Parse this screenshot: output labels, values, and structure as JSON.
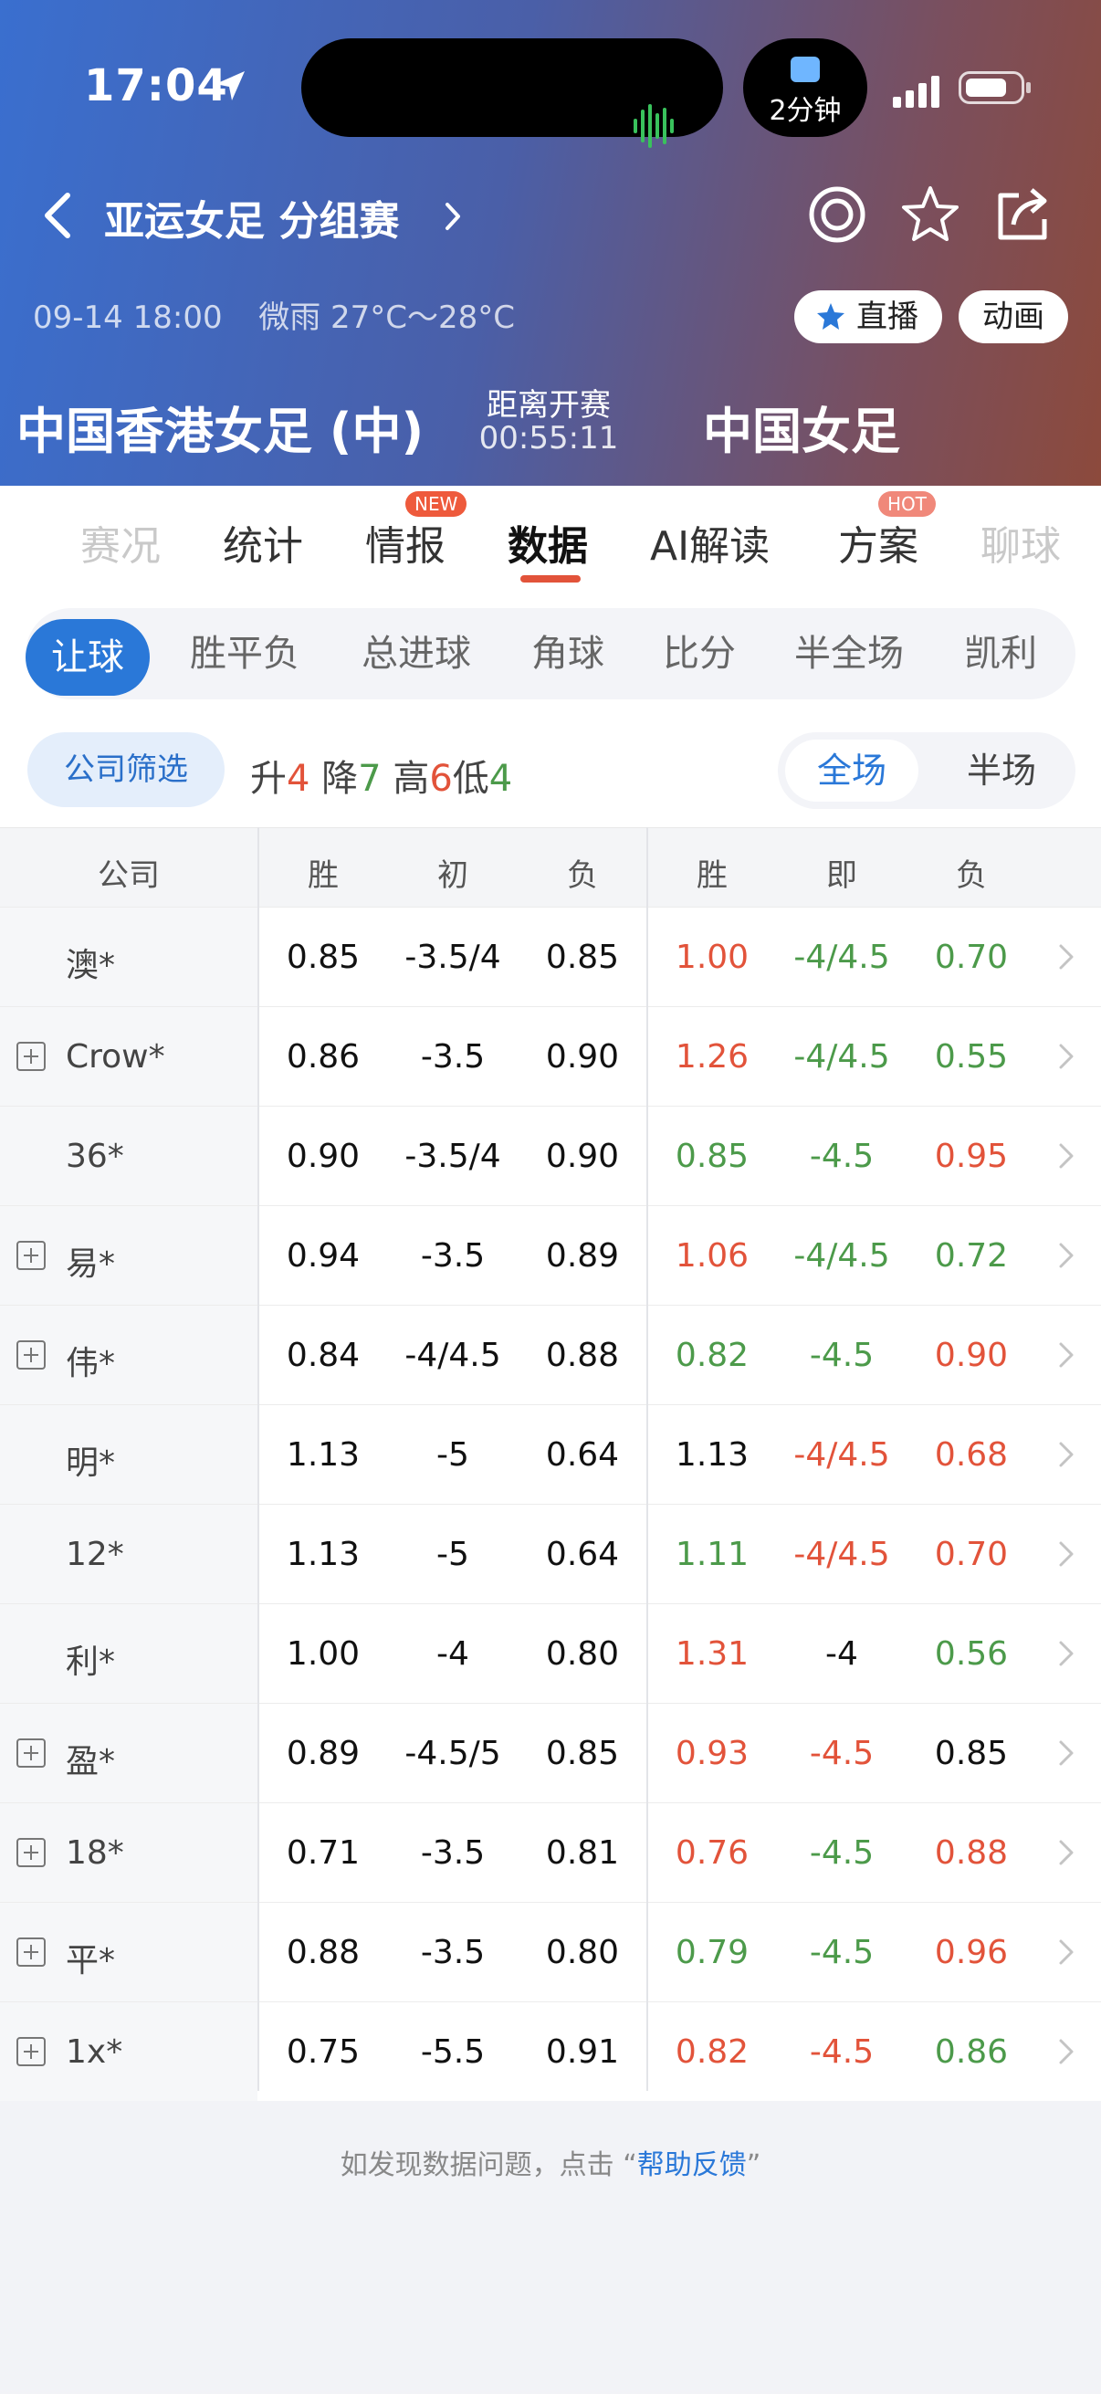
{
  "status_bar": {
    "time": "17:04",
    "timer": "2分钟"
  },
  "nav": {
    "title": "亚运女足 分组赛"
  },
  "match": {
    "datetime": "09-14 18:00",
    "weather": "微雨 27°C～28°C",
    "live_label": "直播",
    "animation_label": "动画",
    "home_team": "中国香港女足 (中)",
    "away_team": "中国女足",
    "countdown_label": "距离开赛",
    "countdown": "00:55:11"
  },
  "tabs": [
    {
      "label": "赛况"
    },
    {
      "label": "统计"
    },
    {
      "label": "情报",
      "badge": "NEW"
    },
    {
      "label": "数据"
    },
    {
      "label": "AI解读"
    },
    {
      "label": "方案",
      "badge": "HOT"
    },
    {
      "label": "聊球"
    }
  ],
  "active_tab": "数据",
  "subtabs": [
    "让球",
    "胜平负",
    "总进球",
    "角球",
    "比分",
    "半全场",
    "凯利"
  ],
  "active_subtab": "让球",
  "filters": {
    "company_filter": "公司筛选",
    "up_label": "升",
    "up": "4",
    "down_label": "降",
    "down": "7",
    "high_label": "高",
    "high": "6",
    "low_label": "低",
    "low": "4",
    "scope_full": "全场",
    "scope_half": "半场"
  },
  "table": {
    "headers": [
      "公司",
      "胜",
      "初",
      "负",
      "胜",
      "即",
      "负"
    ],
    "rows": [
      {
        "company": "澳*",
        "expandable": false,
        "init": [
          "0.85",
          "-3.5/4",
          "0.85"
        ],
        "live": [
          "1.00",
          "-4/4.5",
          "0.70"
        ],
        "live_colors": [
          "red",
          "green",
          "green"
        ]
      },
      {
        "company": "Crow*",
        "expandable": true,
        "init": [
          "0.86",
          "-3.5",
          "0.90"
        ],
        "live": [
          "1.26",
          "-4/4.5",
          "0.55"
        ],
        "live_colors": [
          "red",
          "green",
          "green"
        ]
      },
      {
        "company": "36*",
        "expandable": false,
        "init": [
          "0.90",
          "-3.5/4",
          "0.90"
        ],
        "live": [
          "0.85",
          "-4.5",
          "0.95"
        ],
        "live_colors": [
          "green",
          "green",
          "red"
        ]
      },
      {
        "company": "易*",
        "expandable": true,
        "init": [
          "0.94",
          "-3.5",
          "0.89"
        ],
        "live": [
          "1.06",
          "-4/4.5",
          "0.72"
        ],
        "live_colors": [
          "red",
          "green",
          "green"
        ]
      },
      {
        "company": "伟*",
        "expandable": true,
        "init": [
          "0.84",
          "-4/4.5",
          "0.88"
        ],
        "live": [
          "0.82",
          "-4.5",
          "0.90"
        ],
        "live_colors": [
          "green",
          "green",
          "red"
        ]
      },
      {
        "company": "明*",
        "expandable": false,
        "init": [
          "1.13",
          "-5",
          "0.64"
        ],
        "live": [
          "1.13",
          "-4/4.5",
          "0.68"
        ],
        "live_colors": [
          "black",
          "red",
          "red"
        ]
      },
      {
        "company": "12*",
        "expandable": false,
        "init": [
          "1.13",
          "-5",
          "0.64"
        ],
        "live": [
          "1.11",
          "-4/4.5",
          "0.70"
        ],
        "live_colors": [
          "green",
          "red",
          "red"
        ]
      },
      {
        "company": "利*",
        "expandable": false,
        "init": [
          "1.00",
          "-4",
          "0.80"
        ],
        "live": [
          "1.31",
          "-4",
          "0.56"
        ],
        "live_colors": [
          "red",
          "black",
          "green"
        ]
      },
      {
        "company": "盈*",
        "expandable": true,
        "init": [
          "0.89",
          "-4.5/5",
          "0.85"
        ],
        "live": [
          "0.93",
          "-4.5",
          "0.85"
        ],
        "live_colors": [
          "red",
          "red",
          "black"
        ]
      },
      {
        "company": "18*",
        "expandable": true,
        "init": [
          "0.71",
          "-3.5",
          "0.81"
        ],
        "live": [
          "0.76",
          "-4.5",
          "0.88"
        ],
        "live_colors": [
          "red",
          "green",
          "red"
        ]
      },
      {
        "company": "平*",
        "expandable": true,
        "init": [
          "0.88",
          "-3.5",
          "0.80"
        ],
        "live": [
          "0.79",
          "-4.5",
          "0.96"
        ],
        "live_colors": [
          "green",
          "green",
          "red"
        ]
      },
      {
        "company": "1x*",
        "expandable": true,
        "init": [
          "0.75",
          "-5.5",
          "0.91"
        ],
        "live": [
          "0.82",
          "-4.5",
          "0.86"
        ],
        "live_colors": [
          "red",
          "red",
          "green"
        ]
      }
    ]
  },
  "footer": {
    "prefix": "如发现数据问题，点击 “",
    "link": "帮助反馈",
    "suffix": "”"
  },
  "colors": {
    "accent": "#2a78d8",
    "up_red": "#e2533a",
    "down_green": "#4c9a4a",
    "tab_underline": "#e2533a"
  }
}
